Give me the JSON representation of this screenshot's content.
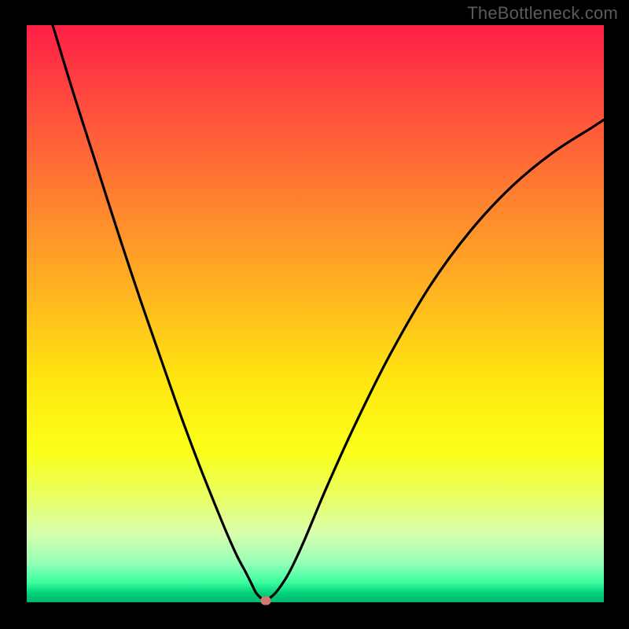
{
  "watermark": "TheBottleneck.com",
  "chart_data": {
    "type": "line",
    "title": "",
    "xlabel": "",
    "ylabel": "",
    "xlim": [
      0,
      100
    ],
    "ylim": [
      0,
      100
    ],
    "grid": false,
    "legend": false,
    "background_gradient": {
      "top": "#ff1f47",
      "mid": "#ffe80f",
      "bottom": "#00b56b",
      "meaning": "top=red(bad), bottom=green(good)"
    },
    "series": [
      {
        "name": "bottleneck-curve",
        "color": "#000000",
        "x": [
          4.5,
          8,
          12,
          16,
          20,
          24,
          27,
          30,
          33,
          35,
          36.5,
          38,
          39,
          39.7,
          40.4,
          41.2,
          42.2,
          43.5,
          45.5,
          48,
          52,
          57,
          63,
          70,
          77,
          84,
          91,
          98,
          100
        ],
        "y": [
          100,
          88.5,
          76,
          63.5,
          51.5,
          40,
          31.5,
          23.5,
          16,
          11.2,
          7.9,
          5.1,
          3.1,
          1.7,
          0.9,
          0.4,
          0.8,
          2.1,
          5.2,
          10.5,
          20,
          31,
          43,
          55,
          64.5,
          72,
          77.8,
          82.3,
          83.6
        ]
      }
    ],
    "markers": [
      {
        "name": "optimal-point",
        "x": 41.4,
        "y": 0.3,
        "color": "#cf7a6a"
      }
    ],
    "annotations": []
  }
}
